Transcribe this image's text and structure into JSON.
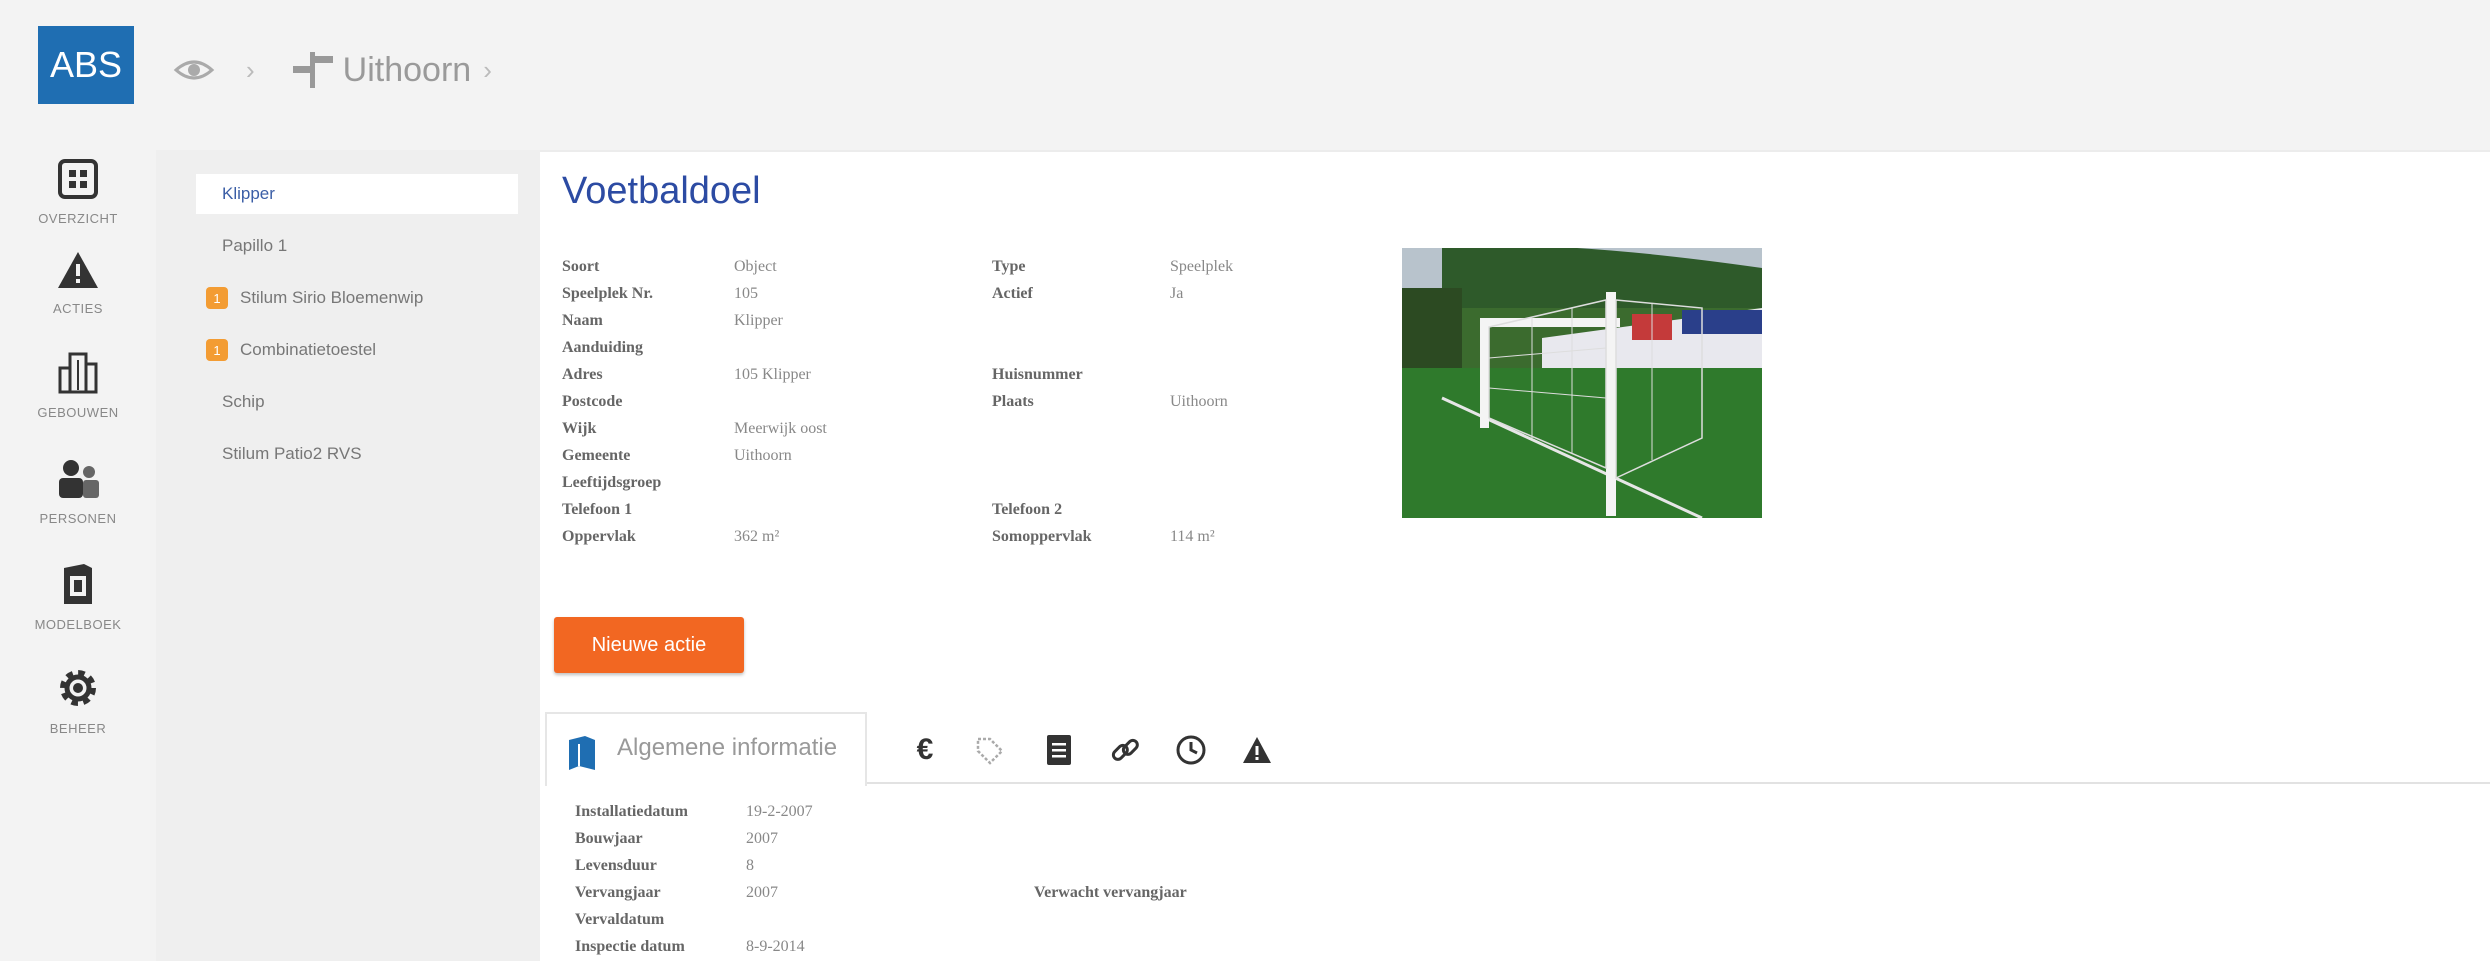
{
  "app": {
    "logo": "ABS"
  },
  "breadcrumb": {
    "location": "Uithoorn"
  },
  "rail": [
    {
      "label": "OVERZICHT",
      "icon": "dashboard-icon"
    },
    {
      "label": "ACTIES",
      "icon": "warning-icon"
    },
    {
      "label": "GEBOUWEN",
      "icon": "building-icon"
    },
    {
      "label": "PERSONEN",
      "icon": "people-icon"
    },
    {
      "label": "MODELBOEK",
      "icon": "book-icon"
    },
    {
      "label": "BEHEER",
      "icon": "gear-icon"
    }
  ],
  "menu": [
    {
      "label": "Klipper",
      "active": true,
      "badge": ""
    },
    {
      "label": "Papillo 1",
      "active": false,
      "badge": ""
    },
    {
      "label": "Stilum Sirio Bloemenwip",
      "active": false,
      "badge": "1"
    },
    {
      "label": "Combinatietoestel",
      "active": false,
      "badge": "1"
    },
    {
      "label": "Schip",
      "active": false,
      "badge": ""
    },
    {
      "label": "Stilum Patio2 RVS",
      "active": false,
      "badge": ""
    }
  ],
  "object": {
    "title": "Voetbaldoel",
    "props_left": [
      {
        "label": "Soort",
        "value": "Object"
      },
      {
        "label": "Speelplek Nr.",
        "value": "105"
      },
      {
        "label": "Naam",
        "value": "Klipper"
      },
      {
        "label": "Aanduiding",
        "value": ""
      },
      {
        "label": "Adres",
        "value": "105 Klipper"
      },
      {
        "label": "Postcode",
        "value": ""
      },
      {
        "label": "Wijk",
        "value": "Meerwijk oost"
      },
      {
        "label": "Gemeente",
        "value": "Uithoorn"
      },
      {
        "label": "Leeftijdsgroep",
        "value": ""
      },
      {
        "label": "Telefoon 1",
        "value": ""
      },
      {
        "label": "Oppervlak",
        "value": "362 m²"
      }
    ],
    "props_right": [
      {
        "label": "Type",
        "value": "Speelplek"
      },
      {
        "label": "Actief",
        "value": "Ja"
      },
      {
        "label": "Huisnummer",
        "value": ""
      },
      {
        "label": "Plaats",
        "value": "Uithoorn"
      },
      {
        "label": "Telefoon 2",
        "value": ""
      },
      {
        "label": "Somoppervlak",
        "value": "114 m²"
      }
    ]
  },
  "actions": {
    "new_action": "Nieuwe actie"
  },
  "tabs": {
    "general_title": "Algemene informatie",
    "icons": [
      "euro-icon",
      "tag-icon",
      "document-icon",
      "link-icon",
      "clock-icon",
      "warning-icon"
    ]
  },
  "general": {
    "rows": [
      {
        "label": "Installatiedatum",
        "value": "19-2-2007"
      },
      {
        "label": "Bouwjaar",
        "value": "2007"
      },
      {
        "label": "Levensduur",
        "value": "8"
      },
      {
        "label": "Vervangjaar",
        "value": "2007"
      },
      {
        "label": "Vervaldatum",
        "value": ""
      },
      {
        "label": "Inspectie datum",
        "value": "8-9-2014"
      }
    ],
    "expected_label": "Verwacht vervangjaar"
  },
  "colors": {
    "accent": "#1f6eb2",
    "action": "#f26722",
    "badge": "#f39c33",
    "title": "#2c4ba3"
  }
}
